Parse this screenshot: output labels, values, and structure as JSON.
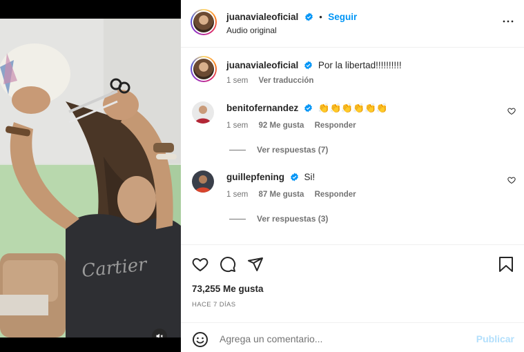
{
  "post": {
    "username": "juanavialeoficial",
    "follow_label": "Seguir",
    "separator": "•",
    "audio_label": "Audio original"
  },
  "caption": {
    "username": "juanavialeoficial",
    "text": "Por la libertad!!!!!!!!!!",
    "time": "1 sem",
    "translate_label": "Ver traducción"
  },
  "comments": [
    {
      "username": "benitofernandez",
      "text": "👏👏👏👏👏👏",
      "time": "1 sem",
      "likes": "92 Me gusta",
      "reply_label": "Responder",
      "view_replies": "Ver respuestas (7)"
    },
    {
      "username": "guillepfening",
      "text": "Si!",
      "time": "1 sem",
      "likes": "87 Me gusta",
      "reply_label": "Responder",
      "view_replies": "Ver respuestas (3)"
    }
  ],
  "footer": {
    "likes": "73,255 Me gusta",
    "date": "HACE 7 DÍAS",
    "comment_placeholder": "Agrega un comentario...",
    "publish_label": "Publicar"
  },
  "icons": {
    "verified": "verified-badge-icon",
    "more": "more-options-icon",
    "like": "heart-icon",
    "comment": "comment-icon",
    "share": "share-icon",
    "save": "bookmark-icon",
    "emoji": "emoji-icon",
    "mute": "muted-speaker-icon"
  },
  "colors": {
    "accent": "#0095f6",
    "publish_disabled": "#b2dffc",
    "secondary_text": "#737373"
  }
}
